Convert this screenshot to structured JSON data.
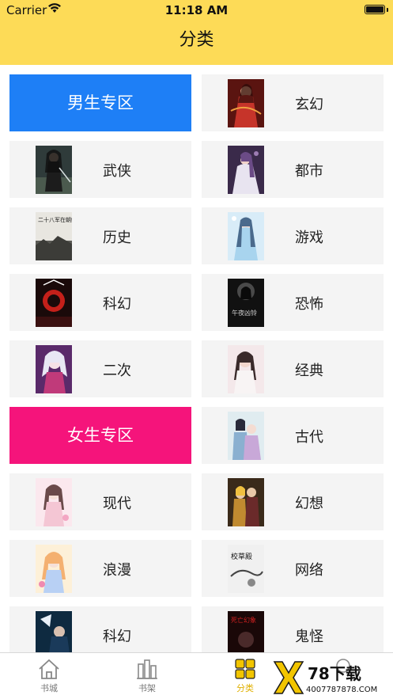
{
  "status_bar": {
    "carrier": "Carrier",
    "time": "11:18 AM"
  },
  "header": {
    "title": "分类"
  },
  "sections": {
    "male": {
      "label": "男生专区",
      "color": "#1e7ff6"
    },
    "female": {
      "label": "女生专区",
      "color": "#f5147b"
    }
  },
  "categories": {
    "xuanhuan": "玄幻",
    "wuxia": "武侠",
    "dushi": "都市",
    "lishi": "历史",
    "youxi": "游戏",
    "kehuan_male": "科幻",
    "kongbu": "恐怖",
    "erci": "二次",
    "jingdian": "经典",
    "gudai": "古代",
    "xiandai": "现代",
    "huanxiang": "幻想",
    "langman": "浪漫",
    "wangluo": "网络",
    "kehuan_female": "科幻",
    "guiguai": "鬼怪"
  },
  "cover_texts": {
    "lishi": "二十八军在朝鲜",
    "kongbu": "午夜凶铃",
    "wangluo": "校草殿",
    "guiguai": "死亡幻象"
  },
  "tabbar": {
    "tabs": [
      {
        "label": "书城",
        "icon": "home-icon"
      },
      {
        "label": "书架",
        "icon": "bookshelf-icon"
      },
      {
        "label": "分类",
        "icon": "category-grid-icon",
        "active": true
      },
      {
        "label": "",
        "icon": "profile-icon"
      }
    ],
    "active_color": "#f2c500"
  },
  "watermark": {
    "brand": "78下载",
    "site": "4007787878.COM"
  }
}
